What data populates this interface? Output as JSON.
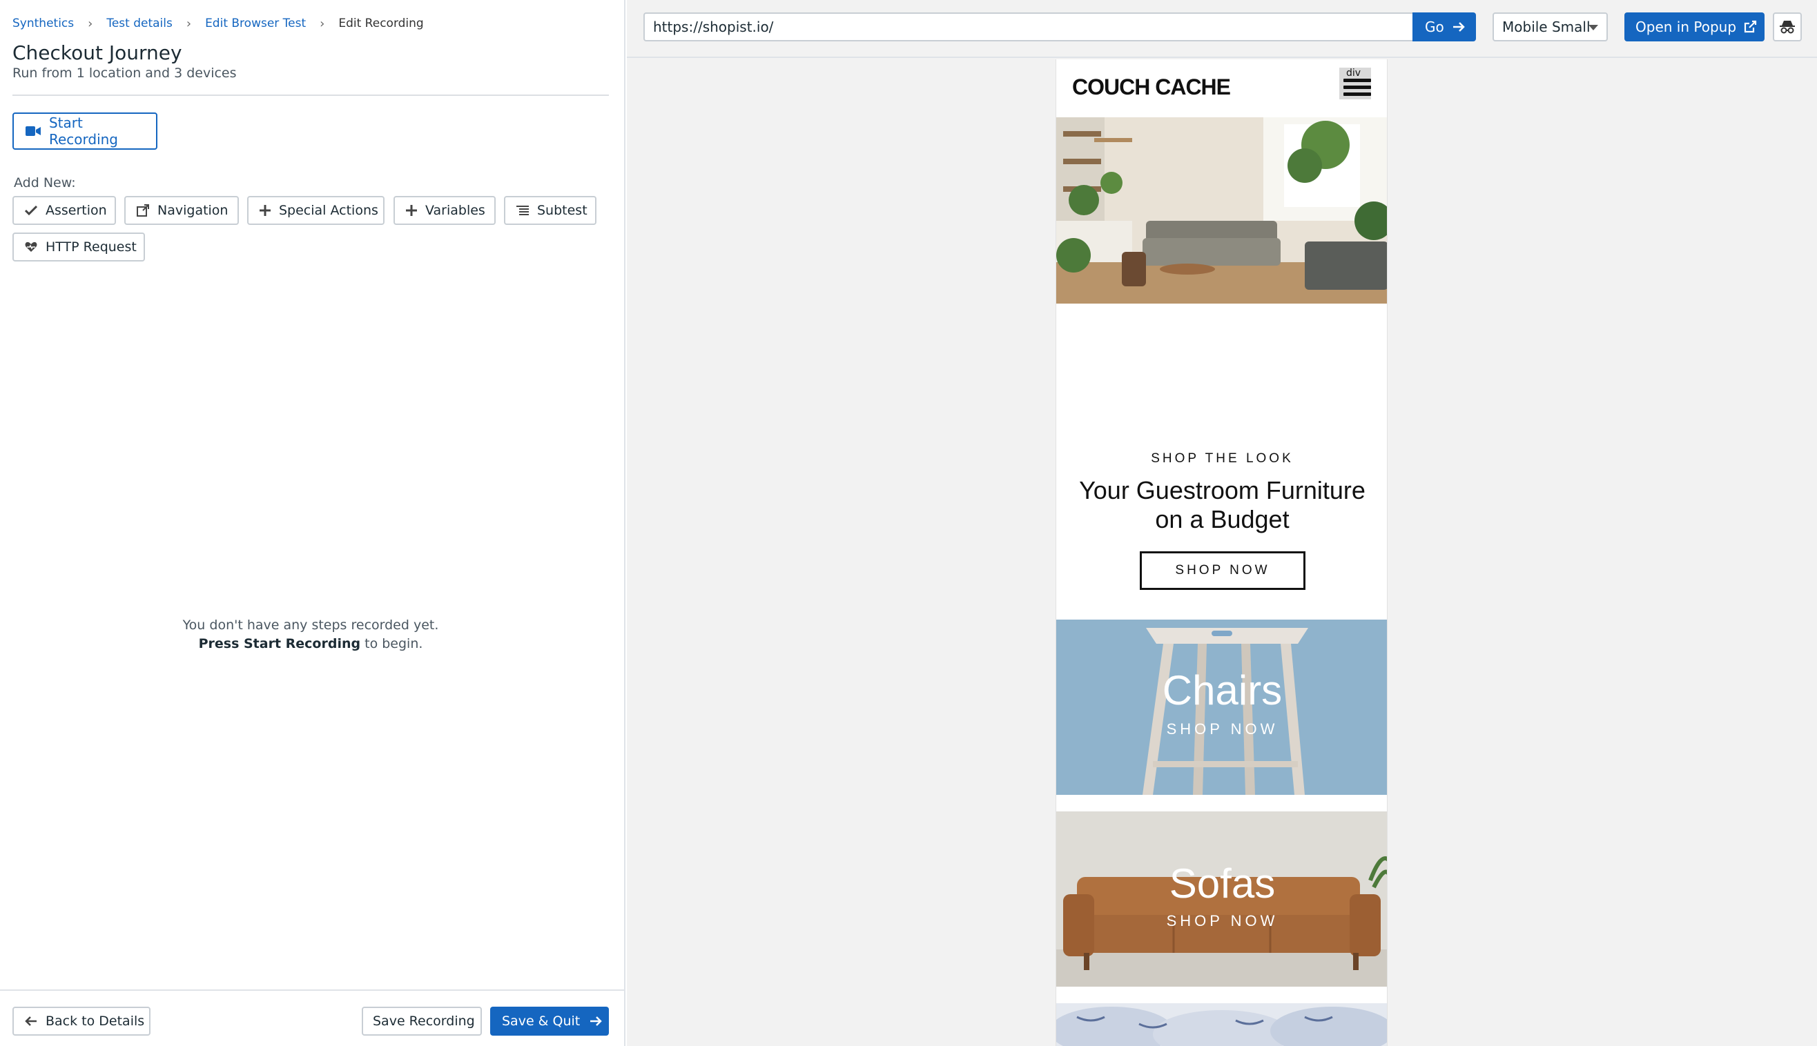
{
  "breadcrumb": {
    "items": [
      "Synthetics",
      "Test details",
      "Edit Browser Test"
    ],
    "current": "Edit Recording"
  },
  "test": {
    "title": "Checkout Journey",
    "subtitle": "Run from 1 location and 3 devices"
  },
  "recording": {
    "start_label": "Start Recording",
    "add_new_label": "Add New:",
    "add_buttons": [
      "Assertion",
      "Navigation",
      "Special Actions",
      "Variables",
      "Subtest",
      "HTTP Request"
    ]
  },
  "empty_state": {
    "line1": "You don't have any steps recorded yet.",
    "bold": "Press Start Recording",
    "rest": " to begin."
  },
  "footer": {
    "back_label": "Back to Details",
    "save_label": "Save Recording",
    "save_quit_label": "Save & Quit"
  },
  "browser": {
    "url": "https://shopist.io/",
    "go_label": "Go",
    "device": "Mobile Small",
    "popup_label": "Open in Popup"
  },
  "site": {
    "logo": "COUCH CACHE",
    "menu_tag": "div",
    "promo_kicker": "SHOP THE LOOK",
    "promo_heading": "Your Guestroom Furniture on a Budget",
    "promo_cta": "SHOP NOW",
    "categories": [
      {
        "title": "Chairs",
        "cta": "SHOP NOW"
      },
      {
        "title": "Sofas",
        "cta": "SHOP NOW"
      }
    ]
  },
  "colors": {
    "accent": "#1566c0",
    "chairs_bg": "#8fb3cc",
    "sofas_bg": "#d8d8d3"
  }
}
